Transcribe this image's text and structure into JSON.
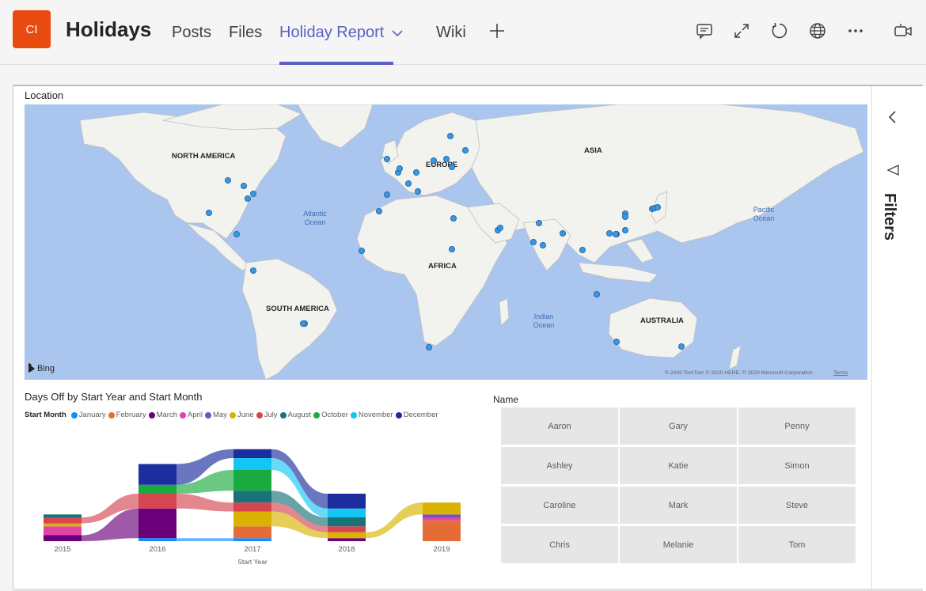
{
  "app": {
    "avatar_initials": "CI",
    "channel_title": "Holidays",
    "tabs": [
      {
        "label": "Posts"
      },
      {
        "label": "Files"
      },
      {
        "label": "Holiday Report"
      },
      {
        "label": "Wiki"
      }
    ],
    "toolbar_icons": [
      "conversation-icon",
      "expand-icon",
      "refresh-icon",
      "globe-icon",
      "more-icon",
      "meet-icon"
    ]
  },
  "map": {
    "title": "Location",
    "continent_labels": [
      "NORTH AMERICA",
      "EUROPE",
      "ASIA",
      "AFRICA",
      "SOUTH AMERICA",
      "AUSTRALIA"
    ],
    "ocean_labels": [
      [
        "Atlantic",
        "Ocean"
      ],
      [
        "Pacific",
        "Ocean"
      ],
      [
        "Indian",
        "Ocean"
      ]
    ],
    "provider": "Bing",
    "copyright": "© 2020 TomTom © 2020 HERE, © 2020 Microsoft Corporation",
    "terms": "Terms"
  },
  "filters": {
    "label": "Filters"
  },
  "chart_data": {
    "type": "bar",
    "title": "Days Off by Start Year and Start Month",
    "legend_title": "Start Month",
    "xlabel": "Start Year",
    "categories": [
      "2015",
      "2016",
      "2017",
      "2018",
      "2019"
    ],
    "series": [
      {
        "name": "January",
        "color": "#118dff",
        "values": [
          0,
          0.5,
          0.5,
          0,
          0
        ]
      },
      {
        "name": "February",
        "color": "#e66c37",
        "values": [
          0,
          0,
          2,
          0,
          3.5
        ]
      },
      {
        "name": "March",
        "color": "#6b007b",
        "values": [
          1,
          5,
          0,
          0.5,
          0
        ]
      },
      {
        "name": "April",
        "color": "#e044a7",
        "values": [
          1.5,
          0,
          0,
          0,
          0.5
        ]
      },
      {
        "name": "May",
        "color": "#744ec2",
        "values": [
          0,
          0,
          0,
          0,
          0.5
        ]
      },
      {
        "name": "June",
        "color": "#d9b300",
        "values": [
          0.5,
          0,
          2.5,
          1,
          2
        ]
      },
      {
        "name": "July",
        "color": "#d64550",
        "values": [
          1,
          2.5,
          1.5,
          1,
          0
        ]
      },
      {
        "name": "August",
        "color": "#197278",
        "values": [
          0.5,
          0,
          2,
          1.5,
          0
        ]
      },
      {
        "name": "October",
        "color": "#1aab40",
        "values": [
          0,
          1.5,
          3.5,
          0,
          0
        ]
      },
      {
        "name": "November",
        "color": "#15c6f4",
        "values": [
          0,
          0,
          2,
          1.5,
          0
        ]
      },
      {
        "name": "December",
        "color": "#1c2da0",
        "values": [
          0,
          3.5,
          1.5,
          2.5,
          0
        ]
      }
    ]
  },
  "slicer": {
    "title": "Name",
    "names": [
      "Aaron",
      "Gary",
      "Penny",
      "Ashley",
      "Katie",
      "Simon",
      "Caroline",
      "Mark",
      "Steve",
      "Chris",
      "Melanie",
      "Tom"
    ]
  }
}
